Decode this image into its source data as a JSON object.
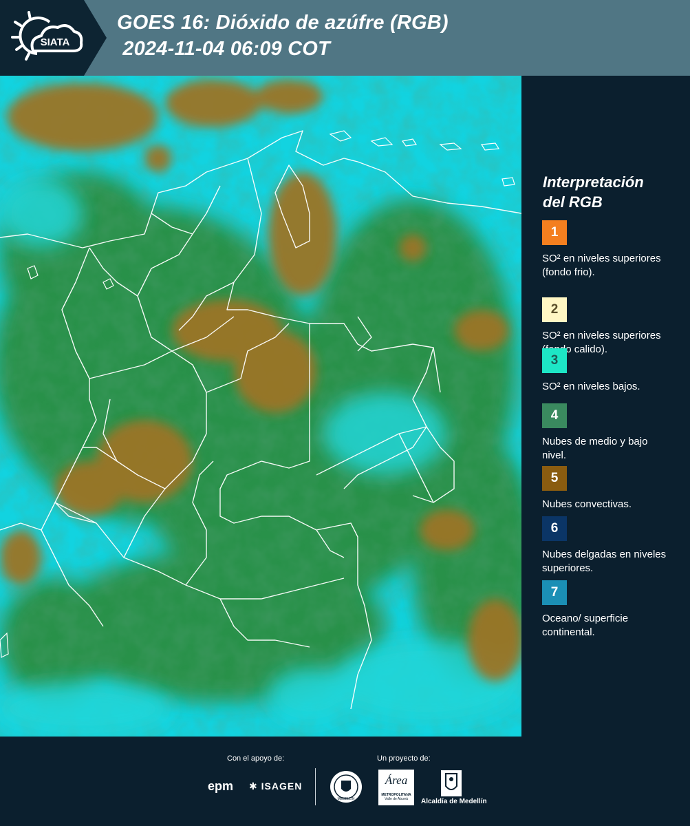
{
  "header": {
    "logo_text": "SIATA",
    "title_line1": "GOES 16: Dióxido de azúfre (RGB)",
    "title_line2": " 2024-11-04 06:09 COT"
  },
  "legend": {
    "title_line1": "Interpretación",
    "title_line2": "del RGB",
    "items": [
      {
        "number": "1",
        "color": "#f47f1f",
        "number_color": "#ffffff",
        "label": "SO² en niveles superiores (fondo frio)."
      },
      {
        "number": "2",
        "color": "#fff7c4",
        "number_color": "#5a4f2a",
        "label": "SO² en niveles superiores (fondo calido)."
      },
      {
        "number": "3",
        "color": "#1de6c6",
        "number_color": "#1c5a55",
        "label": "SO² en niveles bajos."
      },
      {
        "number": "4",
        "color": "#3a8a5f",
        "number_color": "#ffffff",
        "label": "Nubes de medio y bajo nivel."
      },
      {
        "number": "5",
        "color": "#8a5c10",
        "number_color": "#ffffff",
        "label": "Nubes convectivas."
      },
      {
        "number": "6",
        "color": "#0b3566",
        "number_color": "#ffffff",
        "label": "Nubes delgadas en niveles superiores."
      },
      {
        "number": "7",
        "color": "#1b8fb5",
        "number_color": "#ffffff",
        "label": "Oceano/ superficie continental."
      }
    ]
  },
  "footer": {
    "support_label": "Con el apoyo de:",
    "project_label": "Un proyecto de:",
    "sponsor_epm": "epm",
    "sponsor_isagen": "ISAGEN",
    "partner_metropolitana_line1": "Área",
    "partner_metropolitana_line2": "METROPOLITANA",
    "partner_metropolitana_line3": "Valle de Aburrá",
    "partner_alcaldia": "Alcaldía de Medellín",
    "partner_medellin_seal": "MEDELLÍN"
  },
  "map": {
    "colors": {
      "ocean": "#12d3e0",
      "cloud_brown": "#9a7a2a",
      "cloud_green": "#2f8a3a",
      "border": "#ffffff"
    }
  }
}
